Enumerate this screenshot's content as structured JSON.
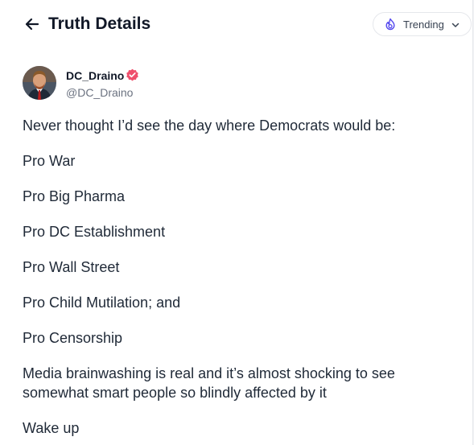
{
  "header": {
    "title": "Truth Details",
    "back_icon": "arrow-left-icon",
    "trending": {
      "label": "Trending",
      "icon": "flame-icon",
      "chevron": "chevron-down-icon",
      "accent": "#5448ee"
    }
  },
  "post": {
    "author": {
      "display_name": "DC_Draino",
      "handle": "@DC_Draino",
      "verified_icon": "verified-badge-icon",
      "verified_color": "#ef4f6c"
    },
    "paragraphs": [
      "Never thought I’d see the day where Democrats would be:",
      "Pro War",
      "Pro Big Pharma",
      "Pro DC Establishment",
      "Pro Wall Street",
      "Pro Child Mutilation; and",
      "Pro Censorship",
      "Media brainwashing is real and it’s almost shocking to see somewhat smart people so blindly affected by it",
      "Wake up"
    ]
  }
}
